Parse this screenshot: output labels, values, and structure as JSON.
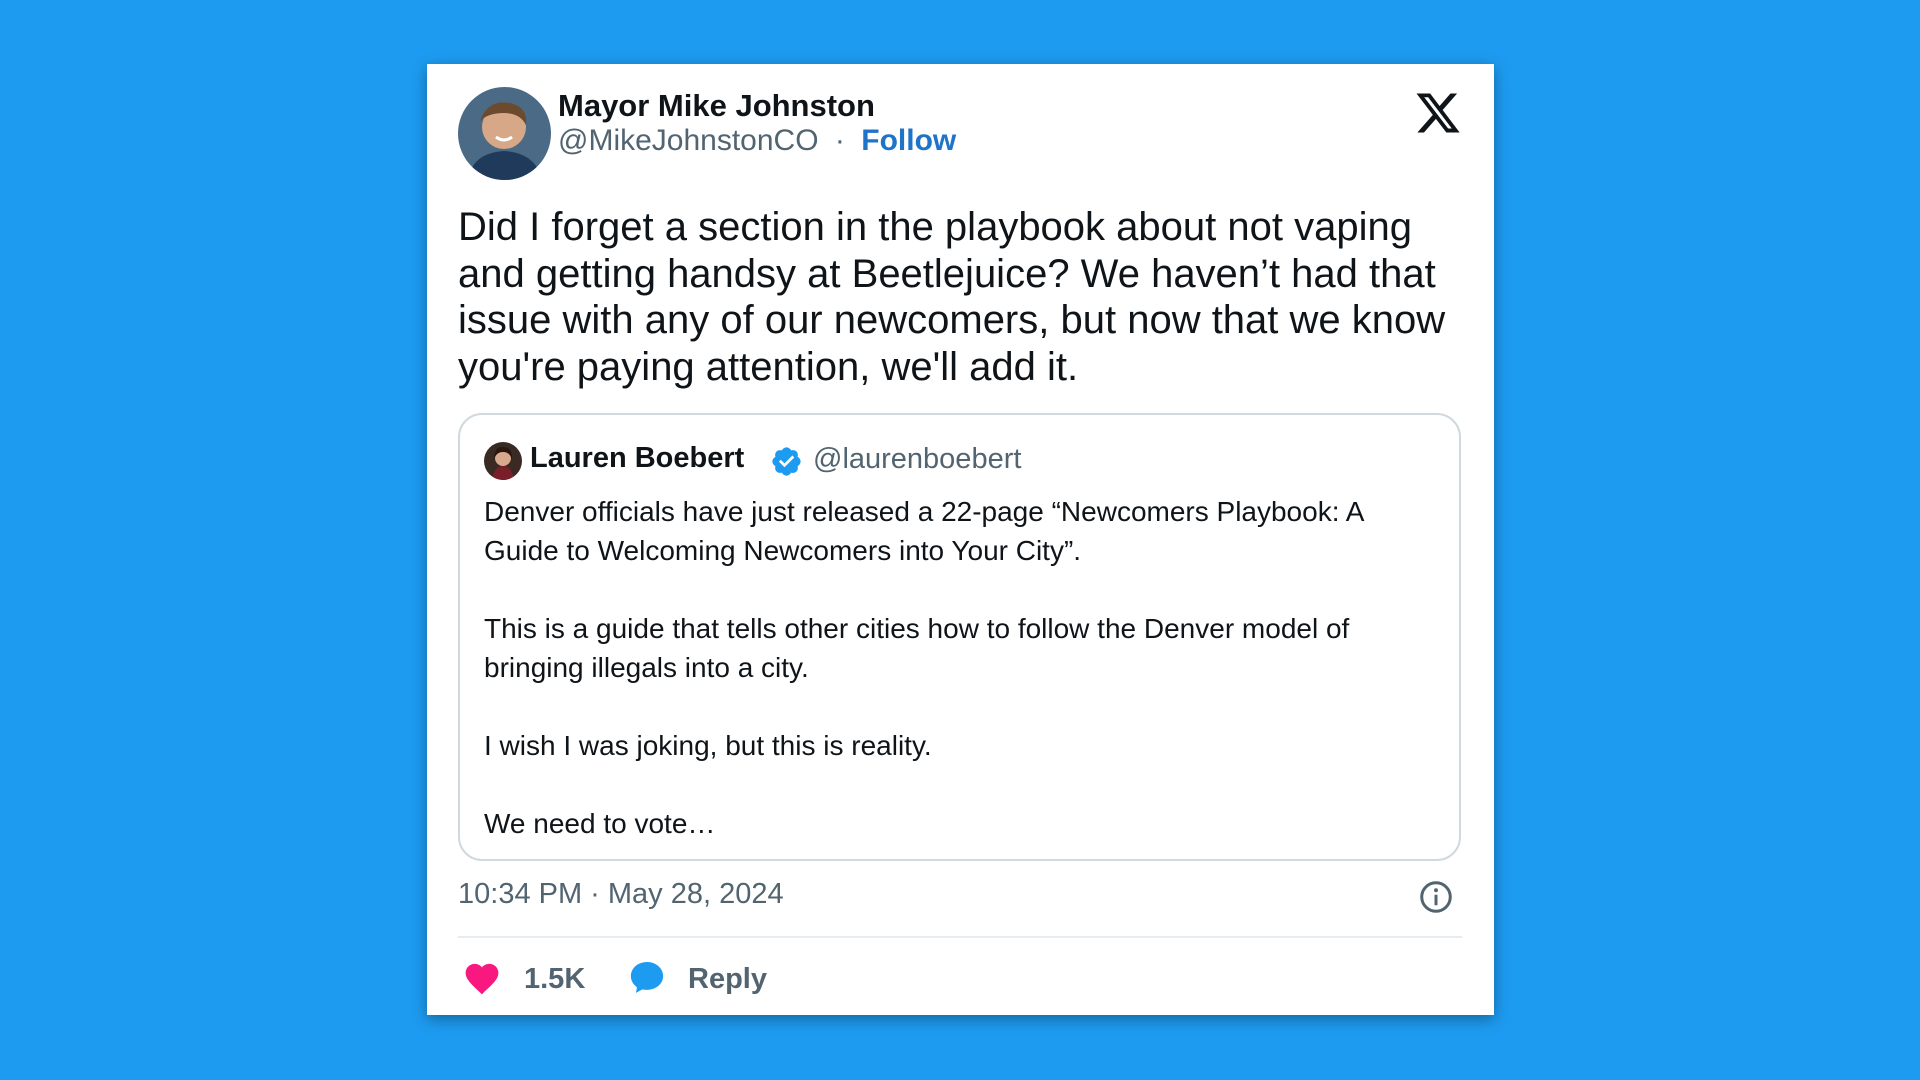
{
  "author": {
    "name": "Mayor Mike Johnston",
    "handle": "@MikeJohnstonCO",
    "separator": "·",
    "follow_label": "Follow"
  },
  "tweet": {
    "text": "Did I forget a section in the playbook about not vaping and getting handsy at Beetlejuice? We haven’t had that issue with any of our newcomers, but now that we know you're paying attention, we'll add it.",
    "timestamp": "10:34 PM · May 28, 2024"
  },
  "quoted": {
    "name": "Lauren Boebert",
    "handle": "@laurenboebert",
    "paragraphs": [
      "Denver officials have just released a 22-page “Newcomers Playbook: A Guide to Welcoming Newcomers into Your City”.",
      "This is a guide that tells other cities how to follow the Denver model of bringing illegals into a city.",
      "I wish I was joking, but this is reality.",
      "We need to vote…"
    ]
  },
  "actions": {
    "likes_count": "1.5K",
    "reply_label": "Reply"
  },
  "icons": {
    "brand": "x-logo-icon",
    "verified": "verified-badge-icon",
    "info": "info-icon",
    "like": "heart-icon",
    "reply": "reply-bubble-icon"
  },
  "colors": {
    "background": "#1d9bf0",
    "follow": "#1d74c9",
    "heart": "#f91880",
    "verified": "#1d9bf0"
  }
}
